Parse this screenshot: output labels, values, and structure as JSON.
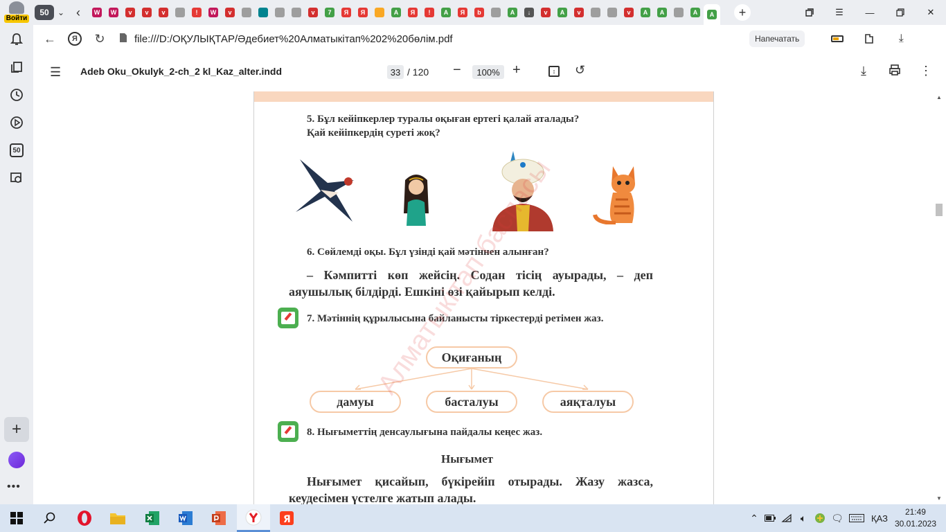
{
  "sidebar": {
    "login_label": "Войти",
    "counter_label": "50"
  },
  "tabs": {
    "count": "50",
    "favicons": [
      {
        "icon": "journal-icon",
        "color": "#c2185b",
        "glyph": "W"
      },
      {
        "icon": "journal-icon",
        "color": "#c2185b",
        "glyph": "W"
      },
      {
        "icon": "shield-v-icon",
        "color": "#d32f2f",
        "glyph": "v"
      },
      {
        "icon": "shield-v-icon",
        "color": "#d32f2f",
        "glyph": "v"
      },
      {
        "icon": "shield-v-icon",
        "color": "#d32f2f",
        "glyph": "v"
      },
      {
        "icon": "document-icon",
        "color": "#9e9e9e",
        "glyph": ""
      },
      {
        "icon": "alert-icon",
        "color": "#e53935",
        "glyph": "!"
      },
      {
        "icon": "journal-icon",
        "color": "#c2185b",
        "glyph": "W"
      },
      {
        "icon": "shield-v-icon",
        "color": "#d32f2f",
        "glyph": "v"
      },
      {
        "icon": "document-icon",
        "color": "#9e9e9e",
        "glyph": ""
      },
      {
        "icon": "leaf-icon",
        "color": "#00838f",
        "glyph": ""
      },
      {
        "icon": "document-icon",
        "color": "#9e9e9e",
        "glyph": ""
      },
      {
        "icon": "document-icon",
        "color": "#9e9e9e",
        "glyph": ""
      },
      {
        "icon": "shield-v-icon",
        "color": "#d32f2f",
        "glyph": "v"
      },
      {
        "icon": "whatsapp-icon",
        "color": "#43a047",
        "glyph": "7"
      },
      {
        "icon": "yandex-icon",
        "color": "#e53935",
        "glyph": "Я"
      },
      {
        "icon": "yandex-icon",
        "color": "#e53935",
        "glyph": "Я"
      },
      {
        "icon": "image-icon",
        "color": "#f9a825",
        "glyph": ""
      },
      {
        "icon": "a-icon",
        "color": "#43a047",
        "glyph": "A"
      },
      {
        "icon": "yandex-icon",
        "color": "#e53935",
        "glyph": "Я"
      },
      {
        "icon": "alert-icon",
        "color": "#e53935",
        "glyph": "!"
      },
      {
        "icon": "a-icon",
        "color": "#43a047",
        "glyph": "A"
      },
      {
        "icon": "yandex-icon",
        "color": "#e53935",
        "glyph": "Я"
      },
      {
        "icon": "b-icon",
        "color": "#e53935",
        "glyph": "b"
      },
      {
        "icon": "document-icon",
        "color": "#9e9e9e",
        "glyph": ""
      },
      {
        "icon": "a-icon",
        "color": "#43a047",
        "glyph": "A"
      },
      {
        "icon": "download-icon",
        "color": "#555555",
        "glyph": "↓"
      },
      {
        "icon": "shield-v-icon",
        "color": "#d32f2f",
        "glyph": "v"
      },
      {
        "icon": "a-icon",
        "color": "#43a047",
        "glyph": "A"
      },
      {
        "icon": "shield-v-icon",
        "color": "#d32f2f",
        "glyph": "v"
      },
      {
        "icon": "document-icon",
        "color": "#9e9e9e",
        "glyph": ""
      },
      {
        "icon": "document-icon",
        "color": "#9e9e9e",
        "glyph": ""
      },
      {
        "icon": "shield-v-icon",
        "color": "#d32f2f",
        "glyph": "v"
      },
      {
        "icon": "a-icon",
        "color": "#43a047",
        "glyph": "A"
      },
      {
        "icon": "a-icon",
        "color": "#43a047",
        "glyph": "A"
      },
      {
        "icon": "document-icon",
        "color": "#9e9e9e",
        "glyph": ""
      },
      {
        "icon": "a-icon",
        "color": "#43a047",
        "glyph": "A"
      },
      {
        "icon": "a-icon",
        "color": "#43a047",
        "glyph": "A"
      }
    ]
  },
  "address": {
    "url": "file:///D:/ОҚУЛЫҚТАР/Әдебиет%20Алматыкітап%202%20бөлім.pdf",
    "print_label": "Напечатать"
  },
  "pdf": {
    "title": "Adeb Oku_Okulyk_2-ch_2 kl_Kaz_alter.indd",
    "page": "33",
    "total": "/ 120",
    "zoom": "100%"
  },
  "page": {
    "q5_line1": "5. Бұл кейіпкерлер туралы оқыған ертегі қалай аталады?",
    "q5_line2": "Қай кейіпкердің суреті жоқ?",
    "q6": "6. Сөйлемді оқы. Бұл үзінді қай мәтіннен алынған?",
    "quote_line1": "– Кәмпитті көп жейсің. Содан тісің ауырады, – деп",
    "quote_line2": "аяушылық білдірді. Ешкіні өзі қайырып келді.",
    "q7": "7. Мәтіннің құрылысына байланысты тіркестерді ретімен жаз.",
    "diagram_top": "Оқиғаның",
    "diagram_left": "дамуы",
    "diagram_mid": "басталуы",
    "diagram_right": "аяқталуы",
    "q8": "8. Нығыметтің денсаулығына пайдалы кеңес жаз.",
    "story_title": "Нығымет",
    "story_line1": "Нығымет қисайып, бүкірейіп отырады. Жазу жазса,",
    "story_line2": "кеудесімен үстелге жатып алады.",
    "watermark": "Алматыкітап баспасы"
  },
  "taskbar": {
    "lang": "ҚАЗ",
    "time": "21:49",
    "date": "30.01.2023"
  }
}
